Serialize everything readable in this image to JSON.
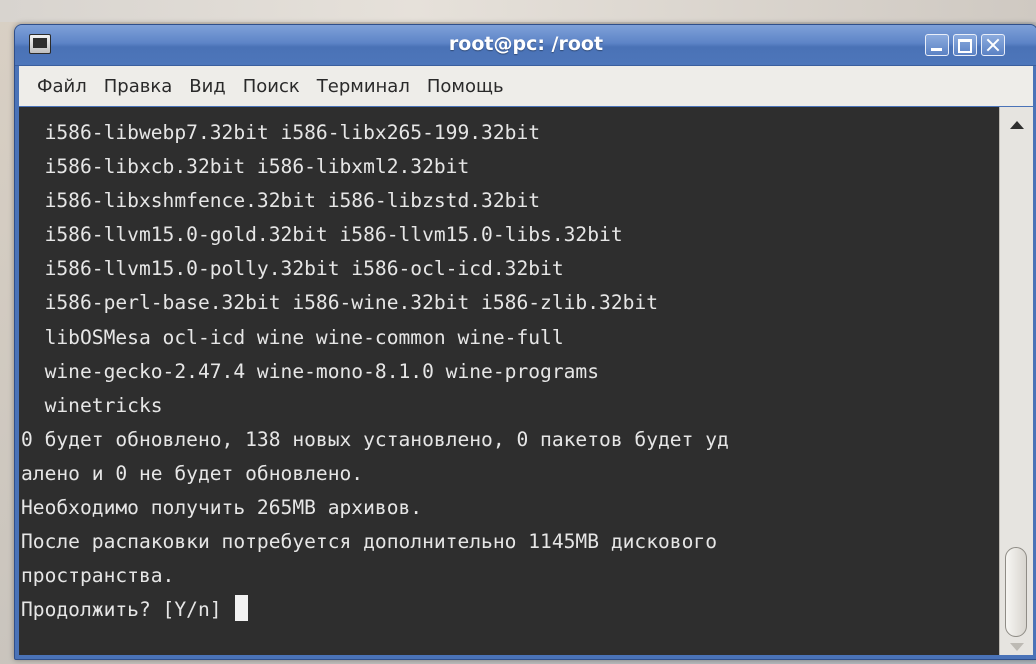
{
  "window": {
    "title": "root@pc: /root"
  },
  "menu": {
    "items": [
      "Файл",
      "Правка",
      "Вид",
      "Поиск",
      "Терминал",
      "Помощь"
    ]
  },
  "terminal": {
    "lines": [
      "  i586-libwebp7.32bit i586-libx265-199.32bit",
      "  i586-libxcb.32bit i586-libxml2.32bit",
      "  i586-libxshmfence.32bit i586-libzstd.32bit",
      "  i586-llvm15.0-gold.32bit i586-llvm15.0-libs.32bit",
      "  i586-llvm15.0-polly.32bit i586-ocl-icd.32bit",
      "  i586-perl-base.32bit i586-wine.32bit i586-zlib.32bit",
      "  libOSMesa ocl-icd wine wine-common wine-full",
      "  wine-gecko-2.47.4 wine-mono-8.1.0 wine-programs",
      "  winetricks",
      "0 будет обновлено, 138 новых установлено, 0 пакетов будет уд",
      "алено и 0 не будет обновлено.",
      "Необходимо получить 265MB архивов.",
      "После распаковки потребуется дополнительно 1145MB дискового",
      "пространства."
    ],
    "prompt": "Продолжить? [Y/n] "
  },
  "colors": {
    "titlebar": "#5d84c7",
    "terminal_bg": "#2e2e2e",
    "terminal_fg": "#e6e6e6",
    "menubar_bg": "#eeede9"
  }
}
